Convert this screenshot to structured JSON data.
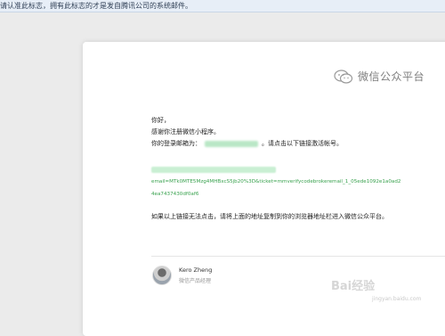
{
  "notice": {
    "text": "请认准此标志，拥有此标志的才是发自腾讯公司的系统邮件。"
  },
  "brand": {
    "name": "微信公众平台"
  },
  "email": {
    "greeting": "你好，",
    "thanks": "感谢你注册微信小程序。",
    "login_label": "你的登录邮箱为：",
    "login_suffix": "。请点击以下链接激活帐号。",
    "link_line1": "email=MTk0MTE5Mzg4MHBxcS5jb20%3D&ticket=mmverifycodebrokeremail_1_05ede1092e1a0ad2",
    "link_line2": "4ea7437430df0af6",
    "fallback_text": "如果以上链接无法点击，请将上面的地址复制到你的浏览器地址栏进入微信公众平台。"
  },
  "signature": {
    "name": "Kero Zheng",
    "title": "微信产品经理"
  },
  "watermark": {
    "text": "Bai经验",
    "url": "jingyan.baidu.com"
  },
  "colors": {
    "link": "#3aa24f",
    "notice_bg": "#e7eef7"
  },
  "icons": [
    "wechat-logo-icon",
    "baidu-paw-icon"
  ]
}
